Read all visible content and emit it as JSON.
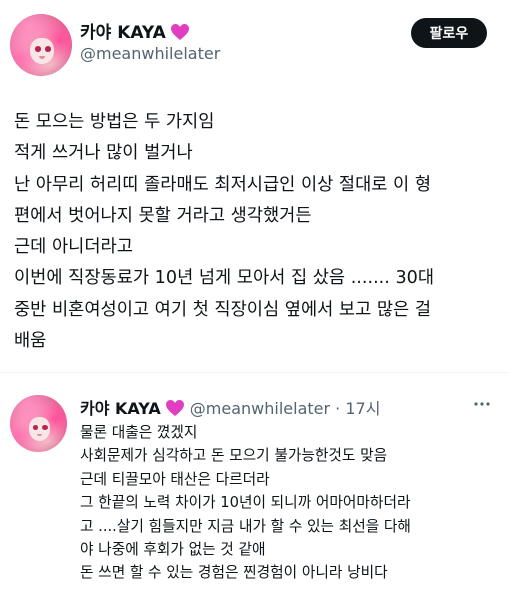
{
  "main_tweet": {
    "author": {
      "display_name": "카야 KAYA",
      "handle": "@meanwhilelater"
    },
    "follow_label": "팔로우",
    "lines": [
      "돈 모으는 방법은 두 가지임",
      "적게 쓰거나 많이 벌거나",
      "난 아무리 허리띠 졸라매도 최저시급인 이상 절대로 이 형",
      "편에서 벗어나지 못할 거라고 생각했거든",
      "근데 아니더라고",
      "이번에 직장동료가 10년 넘게 모아서 집 샀음 ....... 30대",
      "중반 비혼여성이고 여기 첫 직장이심 옆에서 보고 많은 걸",
      "배움"
    ]
  },
  "reply_tweet": {
    "author": {
      "display_name": "카야 KAYA",
      "handle": "@meanwhilelater",
      "separator": " · ",
      "time": "17시"
    },
    "lines": [
      "물론 대출은 꼈겠지",
      "사회문제가 심각하고 돈 모으기 불가능한것도 맞음",
      "근데 티끌모아 태산은 다르더라",
      "그 한끝의 노력 차이가 10년이 되니까 어마어마하더라",
      "고 ....살기 힘들지만 지금 내가 할 수 있는 최선을 다해",
      "야 나중에 후회가 없는 것 같애",
      "돈 쓰면 할 수 있는 경험은 찐경험이 아니라 낭비다"
    ]
  },
  "icons": {
    "heart": "purple-heart-icon",
    "more": "more-dots-icon"
  },
  "colors": {
    "heart": "#e040c0",
    "follow_button": "#0f1419",
    "secondary_text": "#536471"
  }
}
